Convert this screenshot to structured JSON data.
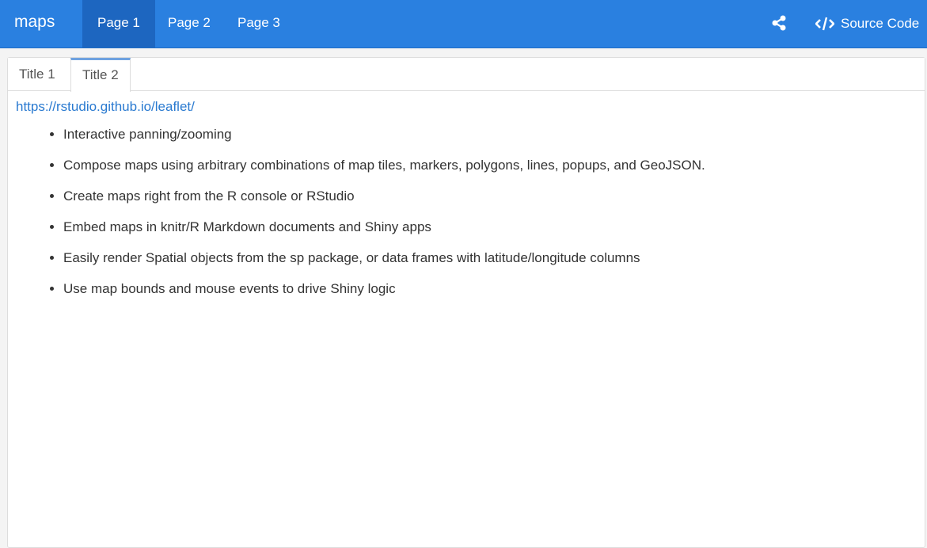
{
  "navbar": {
    "brand": "maps",
    "pages": [
      "Page 1",
      "Page 2",
      "Page 3"
    ],
    "active_page": "Page 1",
    "source_code": "Source Code",
    "accent": "#2a80e0"
  },
  "tabs": {
    "items": [
      "Title 1",
      "Title 2"
    ],
    "active": "Title 2"
  },
  "content": {
    "link": "https://rstudio.github.io/leaflet/",
    "bullets": [
      "Interactive panning/zooming",
      "Compose maps using arbitrary combinations of map tiles, markers, polygons, lines, popups, and GeoJSON.",
      "Create maps right from the R console or RStudio",
      "Embed maps in knitr/R Markdown documents and Shiny apps",
      "Easily render Spatial objects from the sp package, or data frames with latitude/longitude columns",
      "Use map bounds and mouse events to drive Shiny logic"
    ]
  }
}
